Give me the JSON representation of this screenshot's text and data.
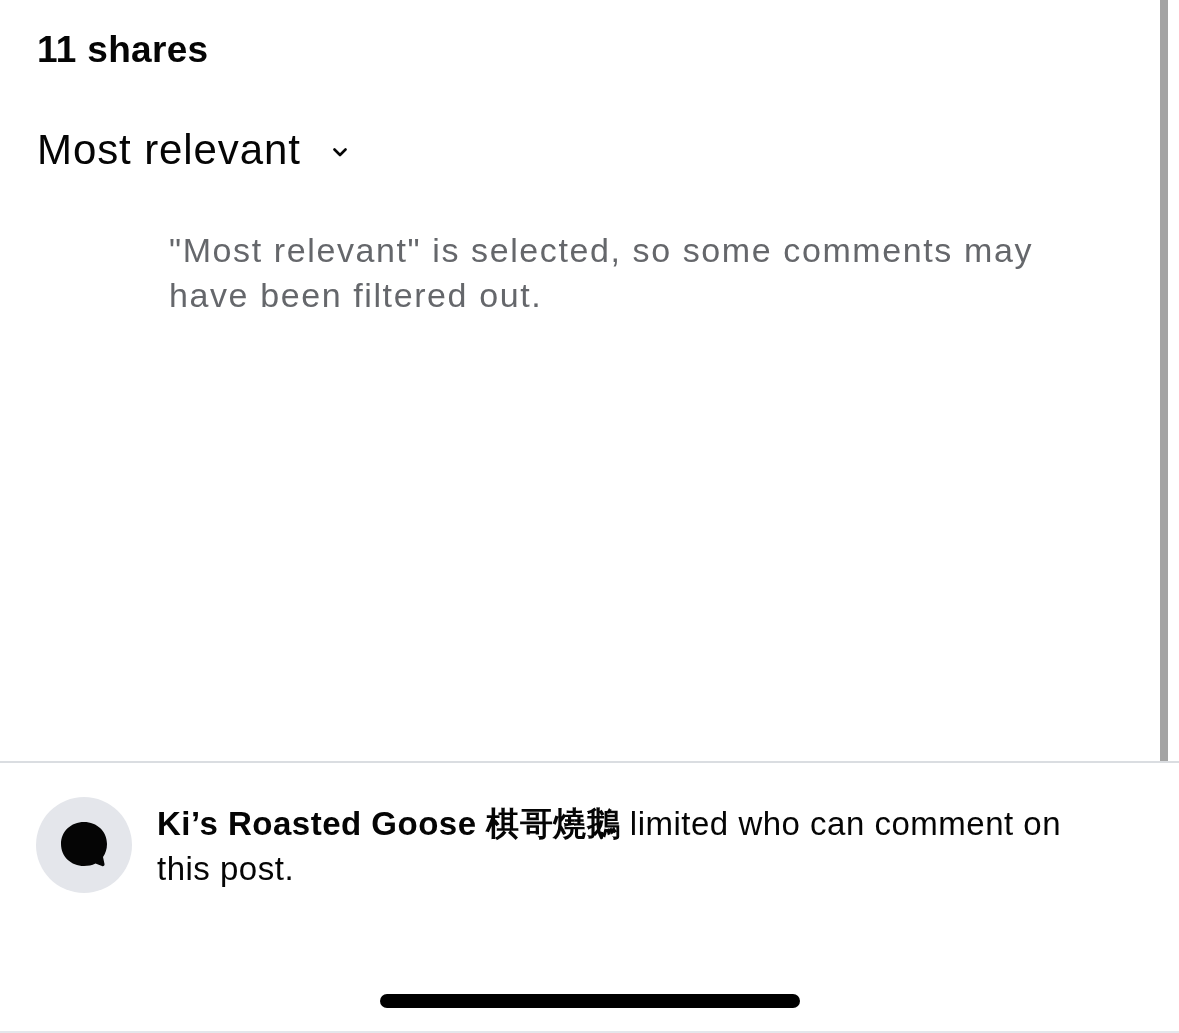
{
  "shares": {
    "text": "11 shares"
  },
  "sort_menu": {
    "label": "Most relevant"
  },
  "filter_note": {
    "text": "\"Most relevant\" is selected, so some comments may have been filtered out."
  },
  "comment_restriction": {
    "text": "**Ki’s Roasted Goose 棋哥燒鵝** limited who can comment on this post."
  }
}
